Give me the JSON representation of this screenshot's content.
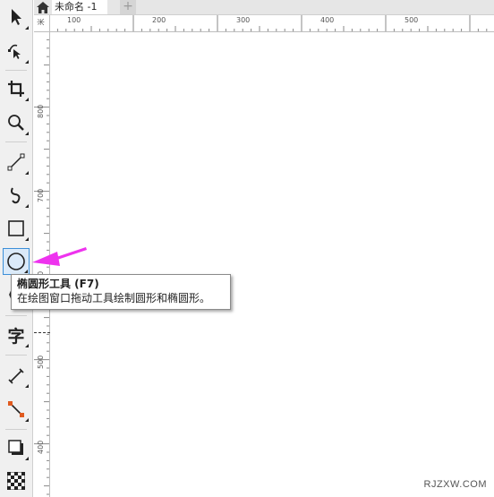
{
  "tabs": {
    "document_title": "未命名 -1",
    "add_tab_glyph": "+"
  },
  "ruler": {
    "horizontal_labels": [
      "100",
      "200",
      "300",
      "400",
      "500"
    ],
    "vertical_labels": [
      "800",
      "700",
      "600",
      "500",
      "400"
    ],
    "unit_hint": "米"
  },
  "toolbox": {
    "text_tool_glyph": "字",
    "active_tool": "ellipse-tool",
    "active_color": "#3c8fd8",
    "tools": [
      {
        "name": "pick-tool",
        "icon": "cursor-arrow-icon"
      },
      {
        "name": "shape-tool",
        "icon": "shape-node-icon"
      },
      {
        "name": "crop-tool",
        "icon": "crop-icon"
      },
      {
        "name": "zoom-tool",
        "icon": "magnifier-icon"
      },
      {
        "name": "freehand-tool",
        "icon": "line-icon"
      },
      {
        "name": "artistic-media-tool",
        "icon": "curve-icon"
      },
      {
        "name": "rectangle-tool",
        "icon": "rectangle-icon"
      },
      {
        "name": "ellipse-tool",
        "icon": "circle-icon"
      },
      {
        "name": "polygon-tool",
        "icon": "polygon-icon"
      },
      {
        "name": "text-tool",
        "icon": "text-icon"
      },
      {
        "name": "dimension-tool",
        "icon": "dimension-icon"
      },
      {
        "name": "connector-tool",
        "icon": "connector-icon"
      },
      {
        "name": "drop-shadow-tool",
        "icon": "shadow-icon"
      },
      {
        "name": "transparency-tool",
        "icon": "checkerboard-icon"
      }
    ]
  },
  "tooltip": {
    "title": "椭圆形工具 (F7)",
    "description": "在绘图窗口拖动工具绘制圆形和椭圆形。"
  },
  "annotation": {
    "arrow_color": "#ee33ee"
  },
  "watermark": "RJZXW.COM"
}
